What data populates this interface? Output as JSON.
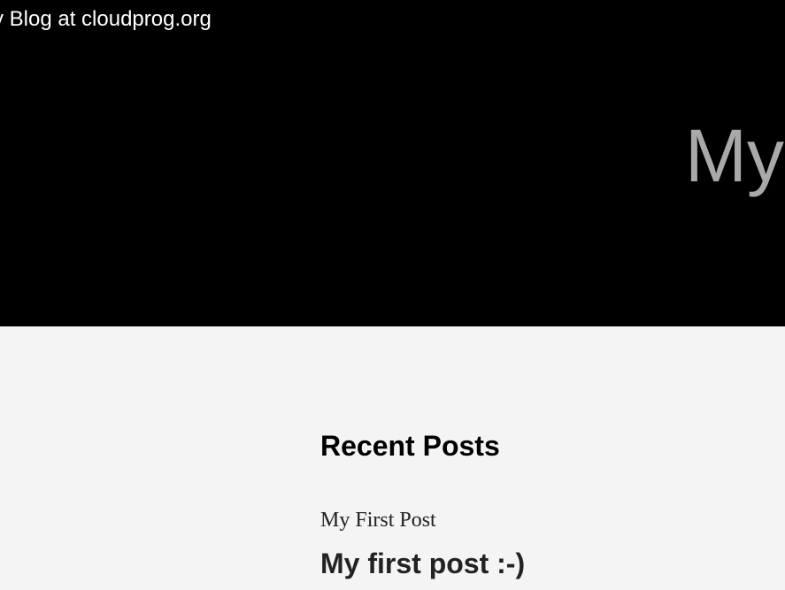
{
  "header": {
    "site_link": "y Blog at cloudprog.org",
    "hero_title": "My"
  },
  "main": {
    "recent_posts_heading": "Recent Posts",
    "recent_posts": [
      {
        "label": "My First Post"
      }
    ],
    "post_title": "My first post :-)"
  },
  "colors": {
    "header_bg": "#000000",
    "page_bg": "#f4f4f4",
    "hero_title": "#a9a9a9",
    "site_link": "#ffffff",
    "heading_text": "#000000",
    "body_text": "#222222"
  }
}
